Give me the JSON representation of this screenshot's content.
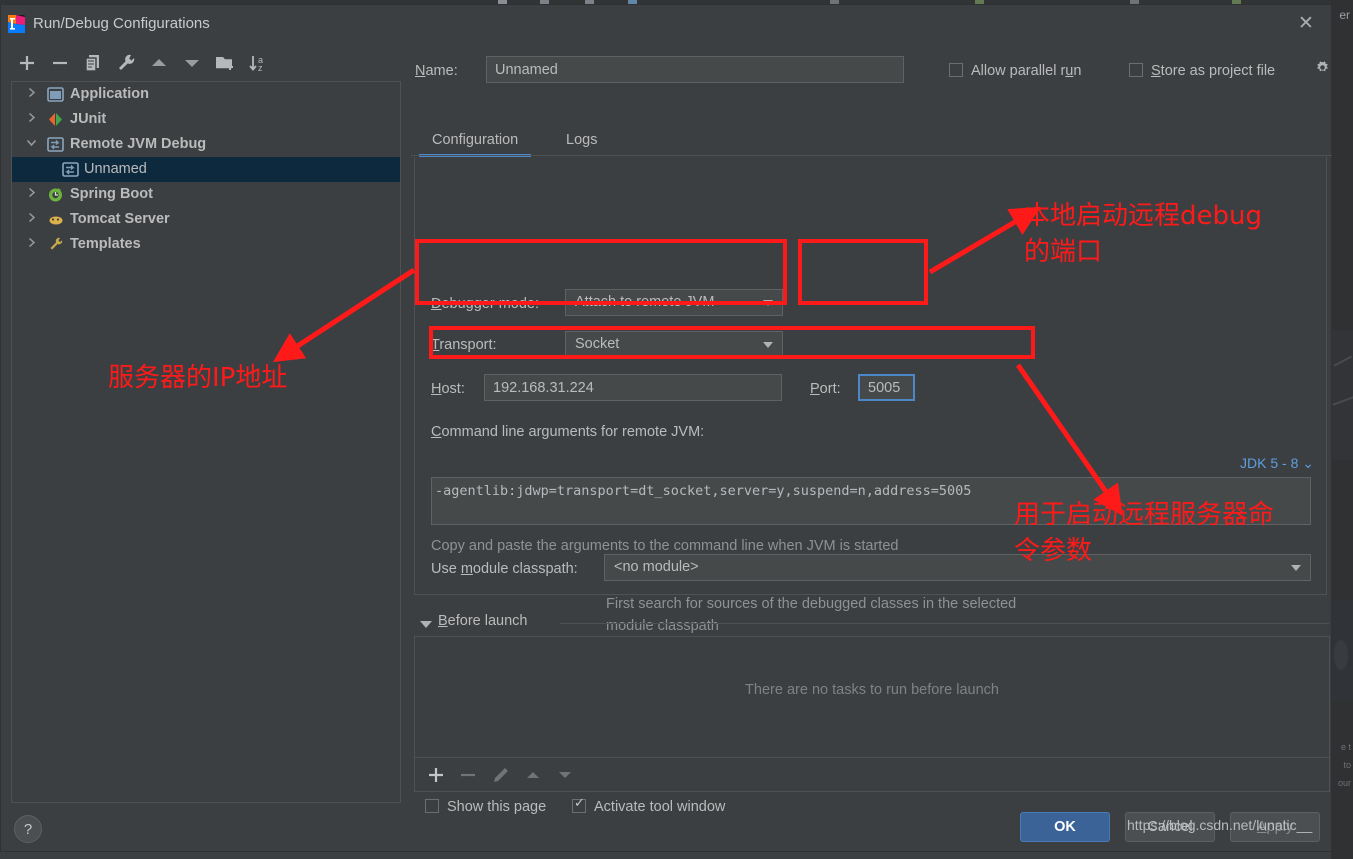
{
  "window": {
    "title": "Run/Debug Configurations",
    "close_label": "✕",
    "app_icon": "intellij-idea-icon"
  },
  "background": {
    "right_edge_label": "er"
  },
  "left_panel": {
    "toolbar": [
      {
        "name": "add-configuration-button",
        "icon": "plus-icon",
        "label": "+"
      },
      {
        "name": "remove-configuration-button",
        "icon": "minus-icon",
        "label": "−"
      },
      {
        "name": "copy-configuration-button",
        "icon": "copy-icon",
        "label": ""
      },
      {
        "name": "edit-templates-button",
        "icon": "wrench-icon",
        "label": ""
      },
      {
        "name": "move-up-button",
        "icon": "arrow-up-icon",
        "label": ""
      },
      {
        "name": "move-down-button",
        "icon": "arrow-down-icon",
        "label": ""
      },
      {
        "name": "new-folder-button",
        "icon": "folder-add-icon",
        "label": ""
      },
      {
        "name": "sort-alphabetically-button",
        "icon": "sort-az-icon",
        "label": ""
      }
    ],
    "tree": [
      {
        "label": "Application",
        "icon": "application-icon",
        "expander": "collapsed",
        "level": 0,
        "selected": false
      },
      {
        "label": "JUnit",
        "icon": "junit-icon",
        "expander": "collapsed",
        "level": 0,
        "selected": false
      },
      {
        "label": "Remote JVM Debug",
        "icon": "remote-jvm-icon",
        "expander": "expanded",
        "level": 0,
        "selected": false
      },
      {
        "label": "Unnamed",
        "icon": "remote-jvm-icon",
        "expander": "none",
        "level": 1,
        "selected": true
      },
      {
        "label": "Spring Boot",
        "icon": "spring-boot-icon",
        "expander": "collapsed",
        "level": 0,
        "selected": false
      },
      {
        "label": "Tomcat Server",
        "icon": "tomcat-icon",
        "expander": "collapsed",
        "level": 0,
        "selected": false
      },
      {
        "label": "Templates",
        "icon": "wrench-icon",
        "expander": "collapsed",
        "level": 0,
        "selected": false
      }
    ],
    "help_button": "?"
  },
  "form": {
    "name_label_pre": "N",
    "name_label_mid": "ame:",
    "name_value": "Unnamed",
    "allow_parallel_run": {
      "label_a": "Allow parallel r",
      "label_u": "u",
      "label_b": "n",
      "checked": false
    },
    "store_as_project_file": {
      "label_s": "S",
      "label_rest": "tore as project file",
      "checked": false
    },
    "gear_icon": "gear-icon"
  },
  "tabs": [
    {
      "label": "Configuration",
      "active": true
    },
    {
      "label": "Logs",
      "active": false
    }
  ],
  "configuration": {
    "debugger_mode": {
      "label_u": "D",
      "label_rest": "ebugger mode:",
      "value": "Attach to remote JVM"
    },
    "transport": {
      "label_u": "T",
      "label_rest": "ransport:",
      "value": "Socket"
    },
    "host": {
      "label_u": "H",
      "label_rest": "ost:",
      "value": "192.168.31.224"
    },
    "port": {
      "label_u": "P",
      "label_rest": "ort:",
      "value": "5005"
    },
    "cmd_args_label_u": "C",
    "cmd_args_label_rest": "ommand line arguments for remote JVM:",
    "cmd_args_value": "-agentlib:jdwp=transport=dt_socket,server=y,suspend=n,address=5005",
    "jdk_selector": "JDK 5 - 8",
    "jdk_selector_caret": "⌄",
    "copy_hint": "Copy and paste the arguments to the command line when JVM is started",
    "module_classpath": {
      "label_a": "Use ",
      "label_u": "m",
      "label_b": "odule classpath:",
      "value": "<no module>"
    },
    "module_hint_line1": "First search for sources of the debugged classes in the selected",
    "module_hint_line2": "module classpath"
  },
  "before_launch": {
    "label_u": "B",
    "label_rest": "efore launch",
    "empty_message": "There are no tasks to run before launch",
    "toolbar": [
      {
        "name": "add-task-button",
        "icon": "plus-icon"
      },
      {
        "name": "remove-task-button",
        "icon": "minus-icon"
      },
      {
        "name": "edit-task-button",
        "icon": "pencil-icon"
      },
      {
        "name": "move-task-up-button",
        "icon": "arrow-up-icon"
      },
      {
        "name": "move-task-down-button",
        "icon": "arrow-down-icon"
      }
    ],
    "show_this_page": {
      "label": "Show this page",
      "checked": false
    },
    "activate_tool_window": {
      "label": "Activate tool window",
      "checked": true
    }
  },
  "buttons": {
    "ok": "OK",
    "cancel": "Cancel",
    "apply_u": "A",
    "apply_rest": "pply"
  },
  "watermark": "https://blog.csdn.net/lunatic__",
  "annotations": {
    "color": "#ff1a1a",
    "server_ip": "服务器的IP地址",
    "port_line1": "本地启动远程debug",
    "port_line2": "的端口",
    "args_line1": "用于启动远程服务器命",
    "args_line2": "令参数"
  }
}
